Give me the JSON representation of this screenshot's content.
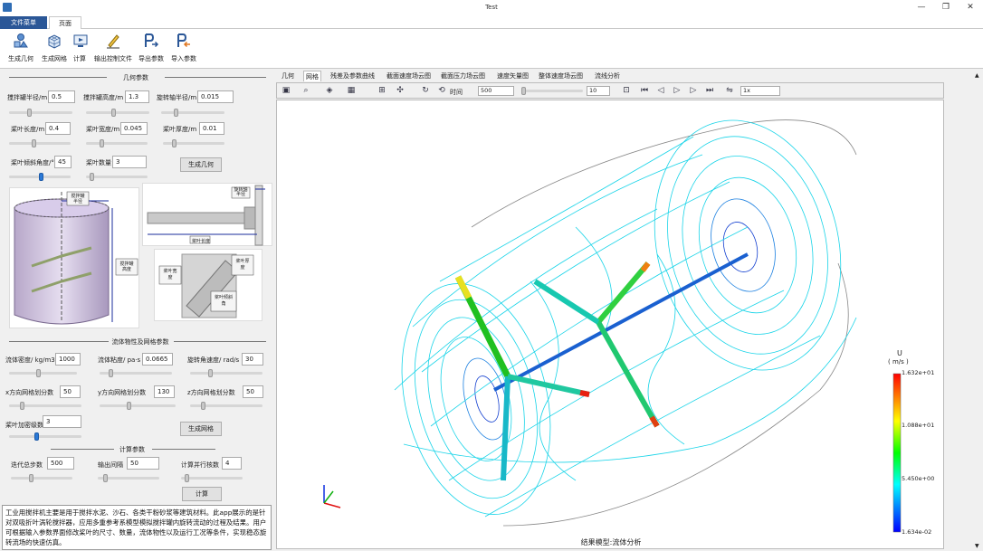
{
  "window": {
    "title": "Test",
    "minimize": "—",
    "restore": "❐",
    "close": "✕"
  },
  "menu_tabs": {
    "file": "文件菜单",
    "page": "页面菜单"
  },
  "ribbon": {
    "build_geometry": "生成几何",
    "build_mesh": "生成网格",
    "compute": "计算",
    "export_control": "输出控制文件",
    "export_params": "导出参数",
    "import_params": "导入参数"
  },
  "geometry": {
    "header": "几何参数",
    "tank_radius_label": "搅拌罐半径/m",
    "tank_radius": "0.5",
    "tank_height_label": "搅拌罐高度/m",
    "tank_height": "1.3",
    "shaft_radius_label": "旋转轴半径/m",
    "shaft_radius": "0.015",
    "blade_length_label": "桨叶长度/m",
    "blade_length": "0.4",
    "blade_width_label": "桨叶宽度/m",
    "blade_width": "0.045",
    "blade_thickness_label": "桨叶厚度/m",
    "blade_thickness": "0.01",
    "blade_angle_label": "桨叶倾斜角度/°",
    "blade_angle": "45",
    "blade_count_label": "桨叶数量",
    "blade_count": "3",
    "build_button": "生成几何",
    "fig_shaft_radius": "搅拌罐半径",
    "fig_tank_height": "搅拌罐高度",
    "fig_rotor_radius": "旋转轴半径",
    "fig_blade_length": "桨叶长度",
    "fig_blade_width": "桨叶宽度",
    "fig_blade_thickness": "桨叶厚度",
    "fig_blade_angle": "桨叶倾斜角"
  },
  "fluid": {
    "header": "流体物性及网格参数",
    "density_label": "流体密度/ kg/m3",
    "density": "1000",
    "viscosity_label": "流体粘度/ pa·s",
    "viscosity": "0.0665",
    "omega_label": "旋转角速度/ rad/s",
    "omega": "30",
    "nx_label": "x方向网格划分数",
    "nx": "50",
    "ny_label": "y方向网格划分数",
    "ny": "130",
    "nz_label": "z方向网格划分数",
    "nz": "50",
    "refine_label": "桨叶加密级数",
    "refine": "3",
    "mesh_button": "生成网格"
  },
  "compute": {
    "header": "计算参数",
    "steps_label": "迭代总步数",
    "steps": "500",
    "interval_label": "输出间隔",
    "interval": "50",
    "threads_label": "计算并行核数",
    "threads": "4",
    "compute_button": "计算"
  },
  "description": "工业用搅拌机主要是用于搅拌水泥、沙石、各类干粉砂浆等建筑材料。此app展示的是针对双吸折叶涡轮搅拌器，应用多重参考系模型模拟搅拌罐内旋转流动的过程及结果。用户可根据输入参数界面修改桨叶的尺寸、数量，流体物性以及运行工况等条件，实现稳态旋转流场的快速仿真。",
  "view_tabs": [
    "几何",
    "网格",
    "残差及参数曲线",
    "截面速度场云图",
    "截面压力场云图",
    "速度矢量图",
    "整体速度场云图",
    "流线分析"
  ],
  "active_view_tab": 7,
  "toolbar": {
    "time_label": "时间",
    "time_value": "500",
    "frame_value": "10",
    "speed_value": "1x"
  },
  "viewport": {
    "caption": "结果模型:流体分析"
  },
  "legend": {
    "variable": "U",
    "unit": "( m/s )",
    "max": "1.632e+01",
    "mid_high": "1.088e+01",
    "mid_low": "5.450e+00",
    "min": "1.634e-02",
    "colors": [
      "#ff0000",
      "#ffff00",
      "#00ff00",
      "#00ffff",
      "#0000ff"
    ]
  }
}
